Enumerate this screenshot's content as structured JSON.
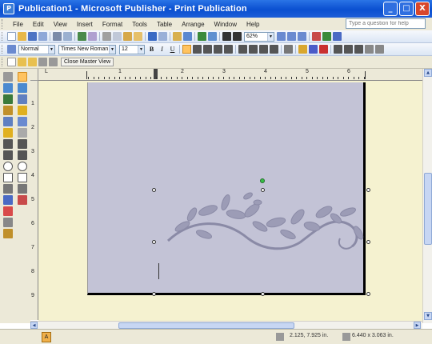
{
  "window": {
    "title": "Publication1 - Microsoft Publisher - Print Publication",
    "app_icon": "P"
  },
  "titlebar_buttons": {
    "minimize": "_",
    "maximize": "□",
    "close": "X"
  },
  "menu": {
    "items": [
      "File",
      "Edit",
      "View",
      "Insert",
      "Format",
      "Tools",
      "Table",
      "Arrange",
      "Window",
      "Help"
    ]
  },
  "help": {
    "placeholder": "Type a question for help"
  },
  "standard_toolbar": {
    "zoom": "62%"
  },
  "formatting_toolbar": {
    "style": "Normal",
    "font": "Times New Roman",
    "size": "12",
    "bold": "B",
    "italic": "I",
    "underline": "U"
  },
  "master_toolbar": {
    "close_master_view": "Close Master View"
  },
  "ruler": {
    "horizontal": [
      "1",
      "2",
      "3",
      "4",
      "5",
      "6"
    ],
    "vertical": [
      "1",
      "2",
      "3",
      "4",
      "5",
      "6",
      "7",
      "8",
      "9"
    ]
  },
  "status": {
    "page_number": "A",
    "position": "2.125, 7.925 in.",
    "size": "6.440 x 3.063 in."
  },
  "colors": {
    "page": "#c3c3d6",
    "canvas": "#f5f2d0",
    "titlebar": "#0a4fd0",
    "ornament": "#9c9cb6"
  },
  "icons": {
    "ornament": "vine-ornament"
  }
}
